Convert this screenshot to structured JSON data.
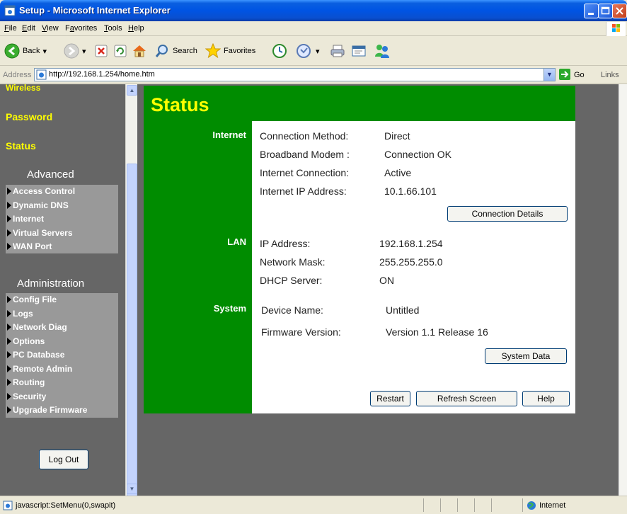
{
  "window": {
    "title": "Setup - Microsoft Internet Explorer"
  },
  "menu": [
    {
      "pre": "",
      "u": "F",
      "post": "ile"
    },
    {
      "pre": "",
      "u": "E",
      "post": "dit"
    },
    {
      "pre": "",
      "u": "V",
      "post": "iew"
    },
    {
      "pre": "F",
      "u": "a",
      "post": "vorites"
    },
    {
      "pre": "",
      "u": "T",
      "post": "ools"
    },
    {
      "pre": "",
      "u": "H",
      "post": "elp"
    }
  ],
  "toolbar": {
    "back": "Back",
    "search": "Search",
    "favorites": "Favorites"
  },
  "address": {
    "label": "Address",
    "url": "http://192.168.1.254/home.htm",
    "go": "Go",
    "links": "Links"
  },
  "nav": {
    "wireless": "Wireless",
    "password": "Password",
    "status": "Status",
    "advanced_title": "Advanced",
    "advanced_items": [
      "Access Control",
      "Dynamic DNS",
      "Internet",
      "Virtual Servers",
      "WAN Port"
    ],
    "admin_title": "Administration",
    "admin_items": [
      "Config File",
      "Logs",
      "Network Diag",
      "Options",
      "PC Database",
      "Remote Admin",
      "Routing",
      "Security",
      "Upgrade Firmware"
    ],
    "logout": "Log Out"
  },
  "page": {
    "title": "Status",
    "internet": {
      "label": "Internet",
      "connection_method_label": "Connection Method:",
      "connection_method": "Direct",
      "modem_label": "Broadband Modem :",
      "modem": "Connection OK",
      "connection_label": "Internet Connection:",
      "connection": "Active",
      "ip_label": "Internet IP Address:",
      "ip": "10.1.66.101",
      "details_button": "Connection Details"
    },
    "lan": {
      "label": "LAN",
      "ip_label": "IP Address:",
      "ip": "192.168.1.254",
      "mask_label": "Network Mask:",
      "mask": "255.255.255.0",
      "dhcp_label": "DHCP Server:",
      "dhcp": "ON"
    },
    "system": {
      "label": "System",
      "device_label": "Device Name:",
      "device": "Untitled",
      "firmware_label": "Firmware Version:",
      "firmware": "Version 1.1 Release 16",
      "system_data_button": "System Data"
    },
    "buttons": {
      "restart": "Restart",
      "refresh": "Refresh Screen",
      "help": "Help"
    }
  },
  "statusbar": {
    "text": "javascript:SetMenu(0,swapit)",
    "zone": "Internet"
  },
  "colors": {
    "nav_bg": "#666666",
    "accent_green": "#008c00",
    "title_yellow": "#ffff00",
    "nav_box": "#999999"
  }
}
